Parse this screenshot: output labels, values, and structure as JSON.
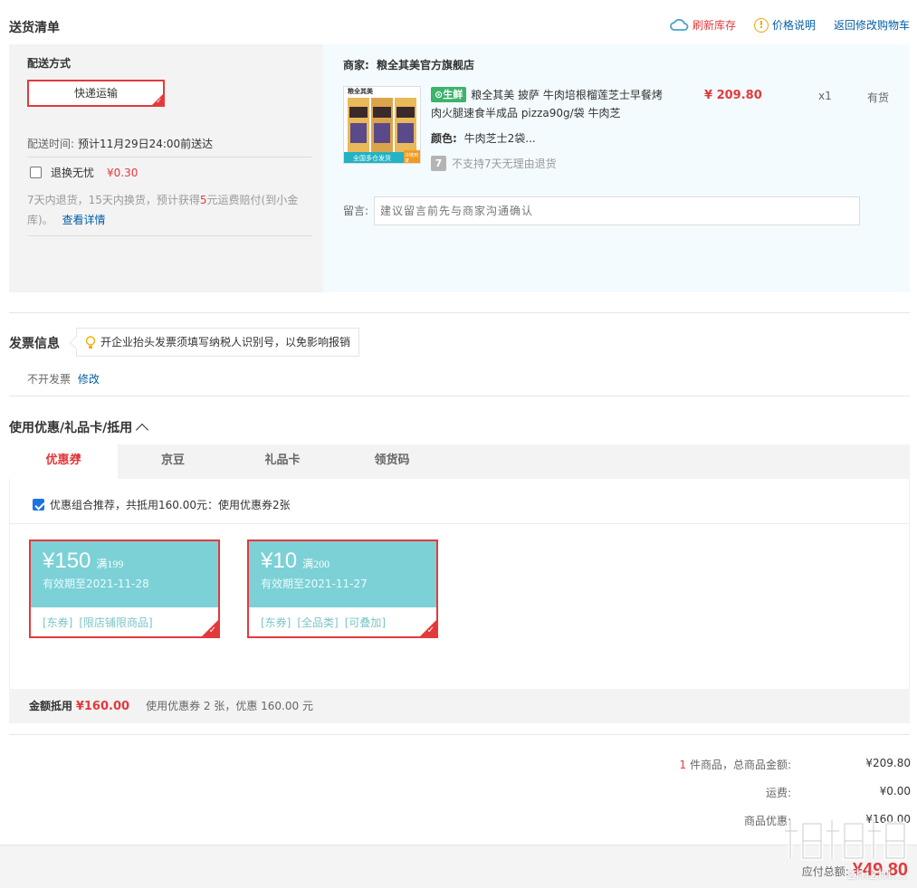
{
  "header": {
    "title": "送货清单",
    "refresh_label": "刷新库存",
    "price_note_label": "价格说明",
    "back_label": "返回修改购物车"
  },
  "shipping": {
    "label": "配送方式",
    "method": "快递运输",
    "time_label": "配送时间:",
    "time_value": "预计11月29日24:00前送达",
    "return_label": "退换无忧",
    "return_price": "¥0.30",
    "return_desc_1": "7天内退货，15天内换货，预计获得",
    "return_desc_num": "5",
    "return_desc_2": "元运费赔付(到小金库)。",
    "return_link": "查看详情"
  },
  "order": {
    "merchant_label": "商家:",
    "merchant_name": "粮全其美官方旗舰店",
    "fresh_badge": "生鲜",
    "product_title": "粮全其美 披萨 牛肉培根榴莲芝士早餐烤肉火腿速食半成品 pizza90g/袋 牛肉芝",
    "price": "¥ 209.80",
    "qty": "x1",
    "stock": "有货",
    "color_label": "颜色:",
    "color_value": "牛肉芝士2袋...",
    "no_return": "不支持7天无理由退货",
    "seven_icon_text": "7",
    "msg_label": "留言:",
    "msg_placeholder": "建议留言前先与商家沟通确认",
    "img_brand": "粮全其美",
    "img_banner": "全国多仓发货",
    "img_corner": "冷链到家"
  },
  "invoice": {
    "title": "发票信息",
    "tip": "开企业抬头发票须填写纳税人识别号，以免影响报销",
    "value": "不开发票",
    "edit": "修改"
  },
  "coupons": {
    "title": "使用优惠/礼品卡/抵用",
    "tabs": [
      "优惠券",
      "京豆",
      "礼品卡",
      "领货码"
    ],
    "combo_text": "优惠组合推荐，共抵用160.00元：使用优惠券2张",
    "items": [
      {
        "symbol": "¥",
        "amount": "150",
        "condition": "满199",
        "expiry": "有效期至2021-11-28",
        "tags": [
          "[东券]",
          "[限店铺限商品]"
        ]
      },
      {
        "symbol": "¥",
        "amount": "10",
        "condition": "满200",
        "expiry": "有效期至2021-11-27",
        "tags": [
          "[东券]",
          "[全品类]",
          "[可叠加]"
        ]
      }
    ],
    "sum_label": "金额抵用",
    "sum_amount": "¥160.00",
    "sum_desc": "使用优惠券 2 张，优惠 160.00 元"
  },
  "totals": {
    "count": "1",
    "count_label": "件商品，总商品金额:",
    "goods_total": "¥209.80",
    "freight_label": "运费:",
    "freight": "¥0.00",
    "discount_label": "商品优惠:",
    "discount": "¥160.00",
    "payable_label": "应付总额:",
    "payable": "¥49.80"
  },
  "watermark": "zhizhi..."
}
